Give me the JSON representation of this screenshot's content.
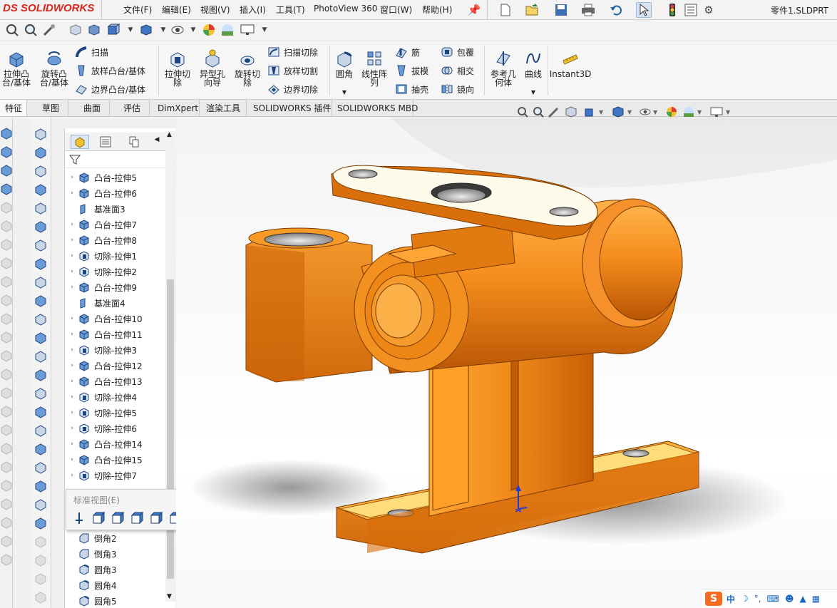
{
  "app": {
    "logo_ds": "DS",
    "logo_brand": "SOLIDWORKS",
    "document_title": "零件1.SLDPRT"
  },
  "menu": [
    "文件(F)",
    "编辑(E)",
    "视图(V)",
    "插入(I)",
    "工具(T)",
    "PhotoView 360",
    "窗口(W)",
    "帮助(H)"
  ],
  "ribbon": {
    "extrude_boss": "拉伸凸\n台/基体",
    "revolve_boss": "旋转凸\n台/基体",
    "sweep": "扫描",
    "loft": "放样凸台/基体",
    "boundary_boss": "边界凸台/基体",
    "extrude_cut": "拉伸切\n除",
    "hole_wizard": "异型孔\n向导",
    "revolve_cut": "旋转切\n除",
    "swept_cut": "扫描切除",
    "lofted_cut": "放样切割",
    "boundary_cut": "边界切除",
    "fillet": "圆角",
    "linear_pattern": "线性阵\n列",
    "rib": "筋",
    "draft": "拔模",
    "shell": "抽壳",
    "wrap": "包覆",
    "intersect": "相交",
    "mirror": "镜向",
    "reference_geometry": "参考几\n何体",
    "curves": "曲线",
    "instant3d": "Instant3D"
  },
  "tabs": [
    "特征",
    "草图",
    "曲面",
    "评估",
    "DimXpert",
    "渲染工具",
    "SOLIDWORKS 插件",
    "SOLIDWORKS MBD"
  ],
  "tree": {
    "items": [
      {
        "label": "凸台-拉伸5",
        "icon": "boss-extrude-icon",
        "expand": true
      },
      {
        "label": "凸台-拉伸6",
        "icon": "boss-extrude-icon",
        "expand": true
      },
      {
        "label": "基准面3",
        "icon": "plane-icon",
        "expand": false
      },
      {
        "label": "凸台-拉伸7",
        "icon": "boss-extrude-icon",
        "expand": true
      },
      {
        "label": "凸台-拉伸8",
        "icon": "boss-extrude-icon",
        "expand": true
      },
      {
        "label": "切除-拉伸1",
        "icon": "cut-extrude-icon",
        "expand": true
      },
      {
        "label": "切除-拉伸2",
        "icon": "cut-extrude-icon",
        "expand": true
      },
      {
        "label": "凸台-拉伸9",
        "icon": "boss-extrude-icon",
        "expand": true
      },
      {
        "label": "基准面4",
        "icon": "plane-icon",
        "expand": false
      },
      {
        "label": "凸台-拉伸10",
        "icon": "boss-extrude-icon",
        "expand": true
      },
      {
        "label": "凸台-拉伸11",
        "icon": "boss-extrude-icon",
        "expand": true
      },
      {
        "label": "切除-拉伸3",
        "icon": "cut-extrude-icon",
        "expand": true
      },
      {
        "label": "凸台-拉伸12",
        "icon": "boss-extrude-icon",
        "expand": true
      },
      {
        "label": "凸台-拉伸13",
        "icon": "boss-extrude-icon",
        "expand": true
      },
      {
        "label": "切除-拉伸4",
        "icon": "cut-extrude-icon",
        "expand": true
      },
      {
        "label": "切除-拉伸5",
        "icon": "cut-extrude-icon",
        "expand": true
      },
      {
        "label": "切除-拉伸6",
        "icon": "cut-extrude-icon",
        "expand": true
      },
      {
        "label": "凸台-拉伸14",
        "icon": "boss-extrude-icon",
        "expand": true
      },
      {
        "label": "凸台-拉伸15",
        "icon": "boss-extrude-icon",
        "expand": true
      },
      {
        "label": "切除-拉伸7",
        "icon": "cut-extrude-icon",
        "expand": true
      }
    ],
    "bottom_items": [
      {
        "label": "倒角2",
        "icon": "chamfer-icon"
      },
      {
        "label": "倒角3",
        "icon": "chamfer-icon"
      },
      {
        "label": "圆角3",
        "icon": "fillet-icon"
      },
      {
        "label": "圆角4",
        "icon": "fillet-icon"
      },
      {
        "label": "圆角5",
        "icon": "fillet-icon"
      }
    ]
  },
  "standard_views": {
    "title": "标准视图(E)"
  },
  "tray": {
    "ime": "中"
  },
  "colors": {
    "part": "#f08a1a",
    "part_dark": "#c65d05",
    "part_light": "#ffb247",
    "flange_top": "#fffbea",
    "accent": "#1b5fa8",
    "logo_red": "#d9261c"
  }
}
